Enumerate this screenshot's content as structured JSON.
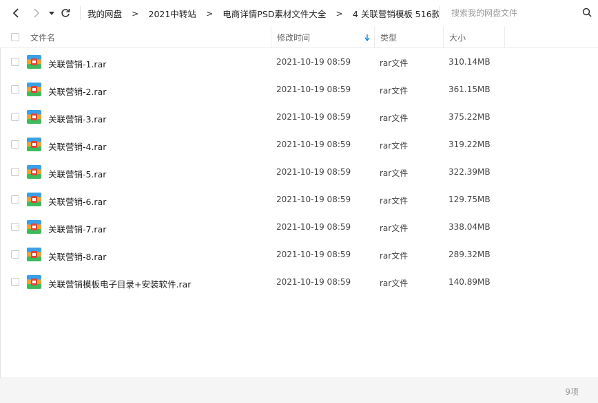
{
  "breadcrumb": [
    "我的网盘",
    "2021中转站",
    "电商详情PSD素材文件大全",
    "4 关联营销模板 516款"
  ],
  "breadcrumb_separator": ">",
  "search": {
    "placeholder": "搜索我的网盘文件"
  },
  "columns": {
    "name": "文件名",
    "date": "修改时间",
    "type": "类型",
    "size": "大小"
  },
  "files": [
    {
      "name": "关联营销-1.rar",
      "date": "2021-10-19 08:59",
      "type": "rar文件",
      "size": "310.14MB"
    },
    {
      "name": "关联营销-2.rar",
      "date": "2021-10-19 08:59",
      "type": "rar文件",
      "size": "361.15MB"
    },
    {
      "name": "关联营销-3.rar",
      "date": "2021-10-19 08:59",
      "type": "rar文件",
      "size": "375.22MB"
    },
    {
      "name": "关联营销-4.rar",
      "date": "2021-10-19 08:59",
      "type": "rar文件",
      "size": "319.22MB"
    },
    {
      "name": "关联营销-5.rar",
      "date": "2021-10-19 08:59",
      "type": "rar文件",
      "size": "322.39MB"
    },
    {
      "name": "关联营销-6.rar",
      "date": "2021-10-19 08:59",
      "type": "rar文件",
      "size": "129.75MB"
    },
    {
      "name": "关联营销-7.rar",
      "date": "2021-10-19 08:59",
      "type": "rar文件",
      "size": "338.04MB"
    },
    {
      "name": "关联营销-8.rar",
      "date": "2021-10-19 08:59",
      "type": "rar文件",
      "size": "289.32MB"
    },
    {
      "name": "关联营销模板电子目录+安装软件.rar",
      "date": "2021-10-19 08:59",
      "type": "rar文件",
      "size": "140.89MB"
    }
  ],
  "footer": {
    "count": "9项"
  },
  "icons": {
    "back": "chevron-left-icon",
    "forward": "chevron-right-icon",
    "dropdown": "caret-down-icon",
    "refresh": "refresh-icon",
    "search": "search-icon",
    "sort": "arrow-down-icon",
    "file": "rar-archive-icon"
  },
  "colors": {
    "sort_arrow": "#1a8ee8",
    "archive_top": "#3aa0e8",
    "archive_mid": "#f0a030",
    "archive_bottom": "#3dbb5c",
    "archive_badge": "#e0453a"
  }
}
